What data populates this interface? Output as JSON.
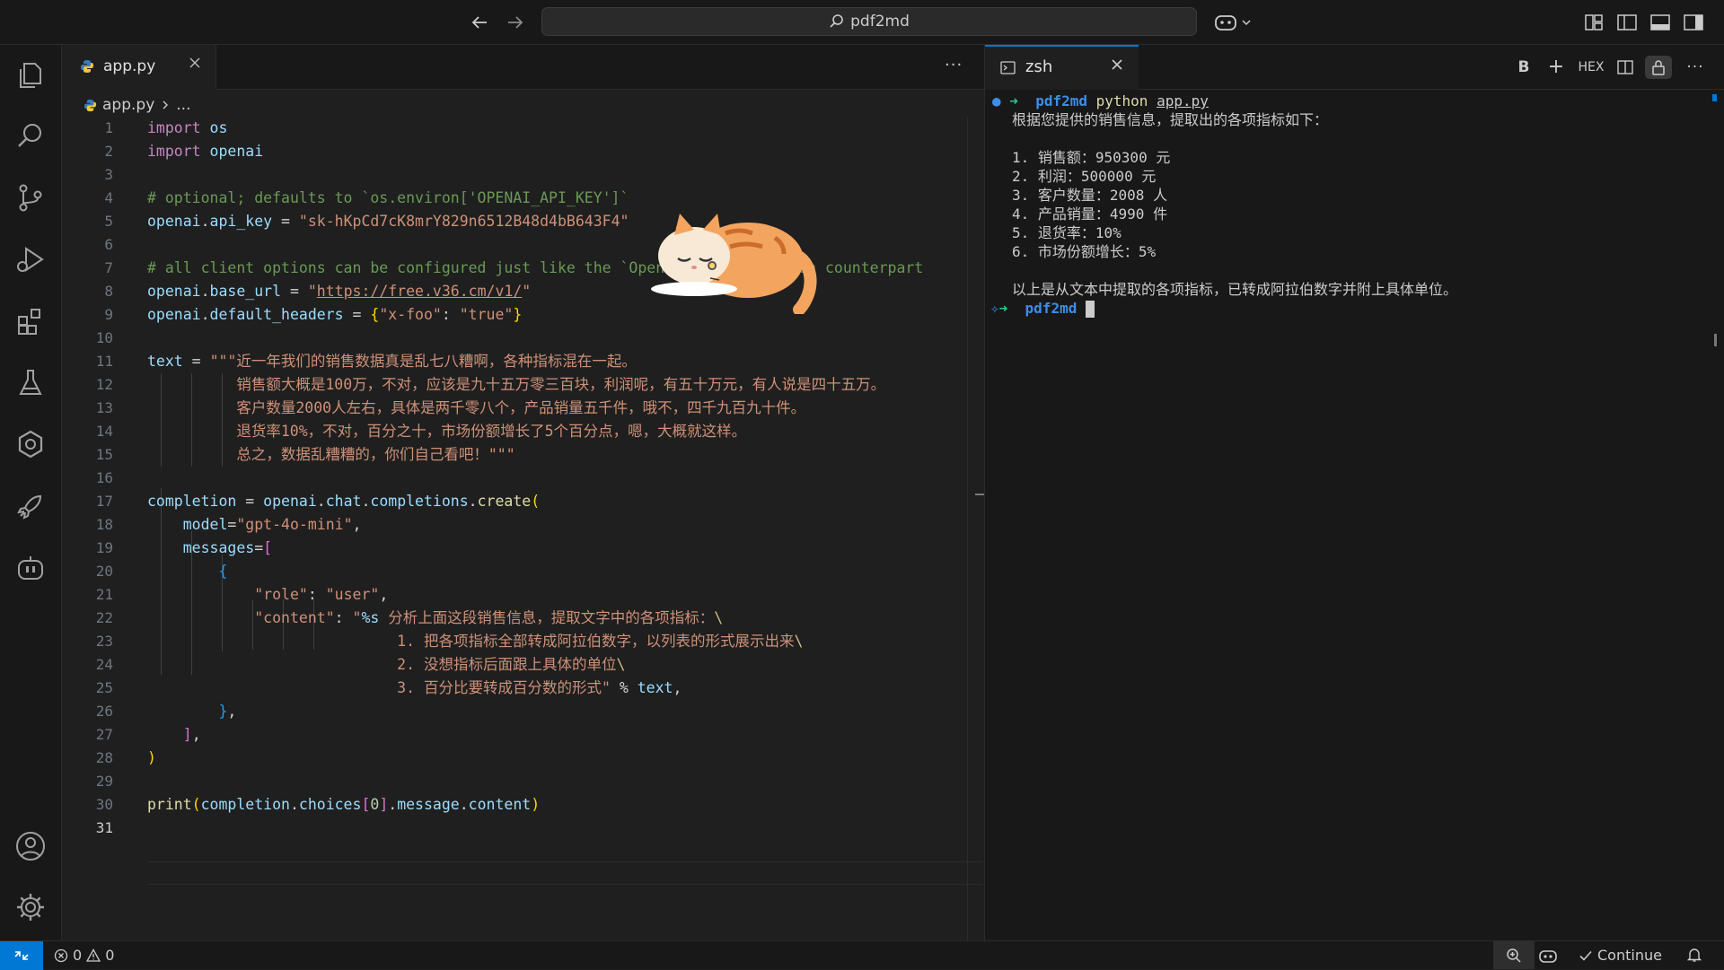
{
  "titlebar": {
    "search_text": "pdf2md",
    "back_icon": "arrow-left-icon",
    "forward_icon": "arrow-right-icon"
  },
  "editor": {
    "tab_label": "app.py",
    "breadcrumb_file": "app.py",
    "breadcrumb_rest": "...",
    "more_actions": "···",
    "active_line": 31
  },
  "terminal": {
    "tab_label": "zsh",
    "prompt_dir": "pdf2md",
    "command_word": "python",
    "command_arg": "app.py",
    "toolbar": [
      "B",
      "+",
      "HEX"
    ],
    "output": [
      "根据您提供的销售信息，提取出的各项指标如下：",
      "",
      "1. 销售额：950300 元",
      "2. 利润：500000 元",
      "3. 客户数量：2008 人",
      "4. 产品销量：4990 件",
      "5. 退货率：10%",
      "6. 市场份额增长：5%",
      "",
      "以上是从文本中提取的各项指标，已转成阿拉伯数字并附上具体单位。"
    ]
  },
  "statusbar": {
    "errors": "0",
    "warnings": "0",
    "continue_label": "Continue"
  },
  "colors": {
    "accent": "#0078d4",
    "keyword": "#c586c0",
    "string": "#ce9178",
    "comment": "#6a9955"
  }
}
